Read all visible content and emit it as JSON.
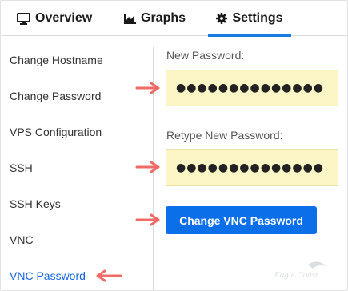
{
  "tabs": [
    {
      "label": "Overview",
      "icon": "monitor-icon"
    },
    {
      "label": "Graphs",
      "icon": "area-chart-icon"
    },
    {
      "label": "Settings",
      "icon": "gear-icon",
      "active": true
    }
  ],
  "sidebar": {
    "items": [
      {
        "label": "Change Hostname"
      },
      {
        "label": "Change Password"
      },
      {
        "label": "VPS Configuration"
      },
      {
        "label": "SSH"
      },
      {
        "label": "SSH Keys"
      },
      {
        "label": "VNC"
      },
      {
        "label": "VNC Password",
        "active": true
      }
    ]
  },
  "form": {
    "new_password_label": "New Password:",
    "new_password_value": "●●●●●●●●●●●●●●",
    "retype_password_label": "Retype New Password:",
    "retype_password_value": "●●●●●●●●●●●●●●",
    "submit_label": "Change VNC Password"
  },
  "colors": {
    "accent": "#1a7be0",
    "button": "#0a6fe8",
    "active_link": "#1565e0",
    "input_bg": "#fcf6c6",
    "annotation_arrow": "#f06a66"
  },
  "watermark": {
    "text": "Eagle Coast"
  }
}
